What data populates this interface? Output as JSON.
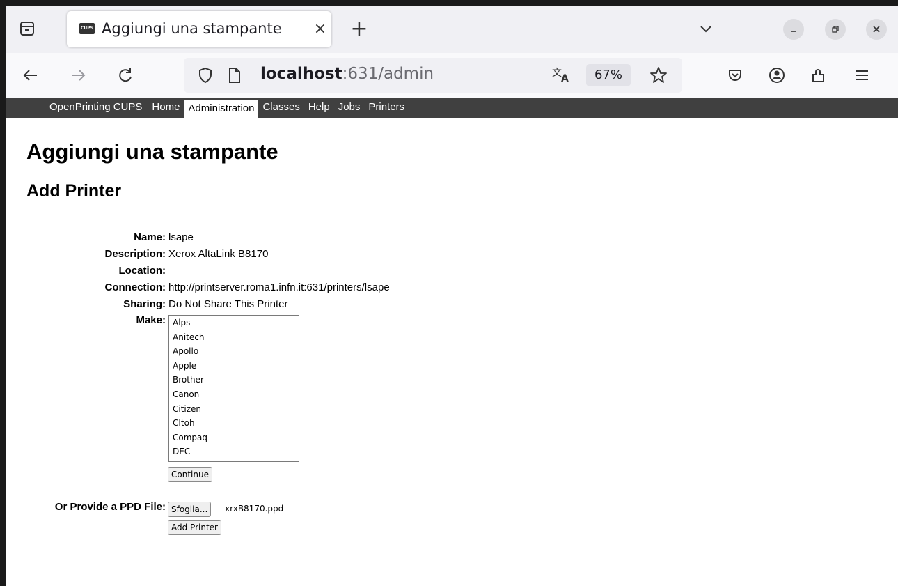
{
  "browser": {
    "tab_title": "Aggiungi una stampante",
    "favicon_text": "CUPS",
    "tab_close": "×",
    "new_tab": "+",
    "url_host": "localhost",
    "url_path": ":631/admin",
    "zoom": "67%"
  },
  "cups_nav": {
    "brand": "OpenPrinting CUPS",
    "items": [
      "Home",
      "Administration",
      "Classes",
      "Help",
      "Jobs",
      "Printers"
    ],
    "active": "Administration"
  },
  "page": {
    "title": "Aggiungi una stampante",
    "heading": "Add Printer"
  },
  "form": {
    "name_label": "Name:",
    "name_value": "lsape",
    "description_label": "Description:",
    "description_value": "Xerox AltaLink B8170",
    "location_label": "Location:",
    "location_value": "",
    "connection_label": "Connection:",
    "connection_value": "http://printserver.roma1.infn.it:631/printers/lsape",
    "sharing_label": "Sharing:",
    "sharing_value": "Do Not Share This Printer",
    "make_label": "Make:",
    "make_options": [
      "Alps",
      "Anitech",
      "Apollo",
      "Apple",
      "Brother",
      "Canon",
      "Citizen",
      "CItoh",
      "Compaq",
      "DEC"
    ],
    "continue_label": "Continue",
    "ppd_label": "Or Provide a PPD File:",
    "browse_label": "Sfoglia...",
    "ppd_file": "xrxB8170.ppd",
    "add_printer_label": "Add Printer"
  }
}
